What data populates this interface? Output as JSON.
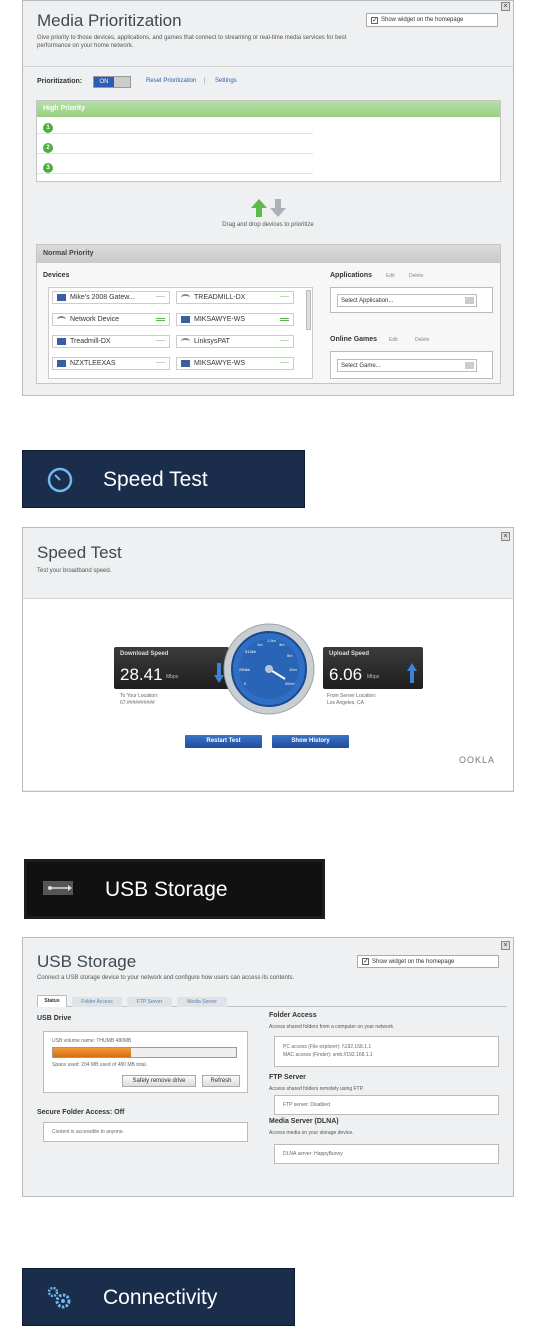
{
  "media_prioritization": {
    "title": "Media Prioritization",
    "description": "Give priority to those devices, applications, and games that connect to streaming or real-time media services for best performance on your home network.",
    "show_widget_label": "Show widget on the homepage",
    "prioritization_label": "Prioritization:",
    "toggle_value": "ON",
    "reset_link": "Reset Prioritization",
    "separator": "|",
    "settings_link": "Settings",
    "high_priority_header": "High Priority",
    "priority_slots": [
      "1",
      "2",
      "3"
    ],
    "drag_hint": "Drag and drop devices to prioritize",
    "normal_priority_header": "Normal Priority",
    "devices_label": "Devices",
    "devices": [
      {
        "name": "Mike's 2008 Gatew...",
        "icon": "laptop-icon",
        "strength": "none"
      },
      {
        "name": "TREADMILL-DX",
        "icon": "wireless-icon",
        "strength": "none"
      },
      {
        "name": "Network Device",
        "icon": "wireless-icon",
        "strength": "strong"
      },
      {
        "name": "MIKSAWYE-WS",
        "icon": "laptop-icon",
        "strength": "strong"
      },
      {
        "name": "Treadmill-DX",
        "icon": "laptop-icon",
        "strength": "none"
      },
      {
        "name": "LinksysPAT",
        "icon": "wireless-icon",
        "strength": "none"
      },
      {
        "name": "NZXTLEEXAS",
        "icon": "laptop-icon",
        "strength": "none"
      },
      {
        "name": "MIKSAWYE-WS",
        "icon": "laptop-icon",
        "strength": "none"
      }
    ],
    "applications_label": "Applications",
    "app_edit": "Edit",
    "app_delete": "Delete",
    "select_application": "Select Application...",
    "online_games_label": "Online Games",
    "games_edit": "Edit",
    "games_delete": "Delete",
    "select_game": "Select Game..."
  },
  "speed_test_banner": {
    "label": "Speed Test",
    "icon": "speedometer-icon"
  },
  "speed_test": {
    "title": "Speed Test",
    "subtitle": "Test your broadband speed.",
    "download_label": "Download Speed",
    "download_value": "28.41",
    "download_unit": "Mbps",
    "to_location_label": "To Your Location:",
    "to_location_value": "67.##########",
    "gauge_ticks": [
      "0",
      "250kb",
      "512kb",
      "1m",
      "1.5m",
      "3m",
      "5m",
      "10m",
      "20m+"
    ],
    "upload_label": "Upload Speed",
    "upload_value": "6.06",
    "upload_unit": "Mbps",
    "from_location_label": "From Server Location:",
    "from_location_value": "Los Angeles, CA",
    "restart_button": "Restart Test",
    "history_button": "Show History",
    "brand": "OOKLA"
  },
  "usb_banner": {
    "label": "USB Storage",
    "icon": "usb-icon"
  },
  "usb_storage": {
    "title": "USB Storage",
    "subtitle": "Connect a USB storage device to your network and configure how users can access its contents.",
    "show_widget_label": "Show widget on the homepage",
    "tabs": [
      "Status",
      "Folder Access",
      "FTP Server",
      "Media Server"
    ],
    "usb_drive_label": "USB Drive",
    "volume_name": "USB volume name: THUMB 480MB",
    "usage_fraction": 0.425,
    "space_used": "Space used: 204 MB used of 480 MB total.",
    "safely_remove_button": "Safely remove drive",
    "refresh_button": "Refresh",
    "secure_label": "Secure Folder Access: Off",
    "secure_text": "Content is accessible to anyone.",
    "folder_access_label": "Folder Access",
    "folder_access_desc": "Access shared folders from a computer on your network.",
    "pc_access": "PC access (File explorer): \\\\192.168.1.1",
    "mac_access": "MAC access (Finder): smb://192.168.1.1",
    "ftp_label": "FTP Server",
    "ftp_desc": "Access shared folders remotely using FTP.",
    "ftp_status": "FTP server: Disabled",
    "media_server_label": "Media Server (DLNA)",
    "media_server_desc": "Access media on your storage device.",
    "dlna_status": "DLNA server: HappyBunny"
  },
  "connectivity_banner": {
    "label": "Connectivity",
    "icon": "gears-icon"
  },
  "colors": {
    "accent_green": "#4fae3e",
    "banner_navy": "#1a2d4a",
    "button_blue": "#2a5fb3",
    "usage_orange": "#e8801f",
    "gauge_blue": "#2e6fc5"
  }
}
